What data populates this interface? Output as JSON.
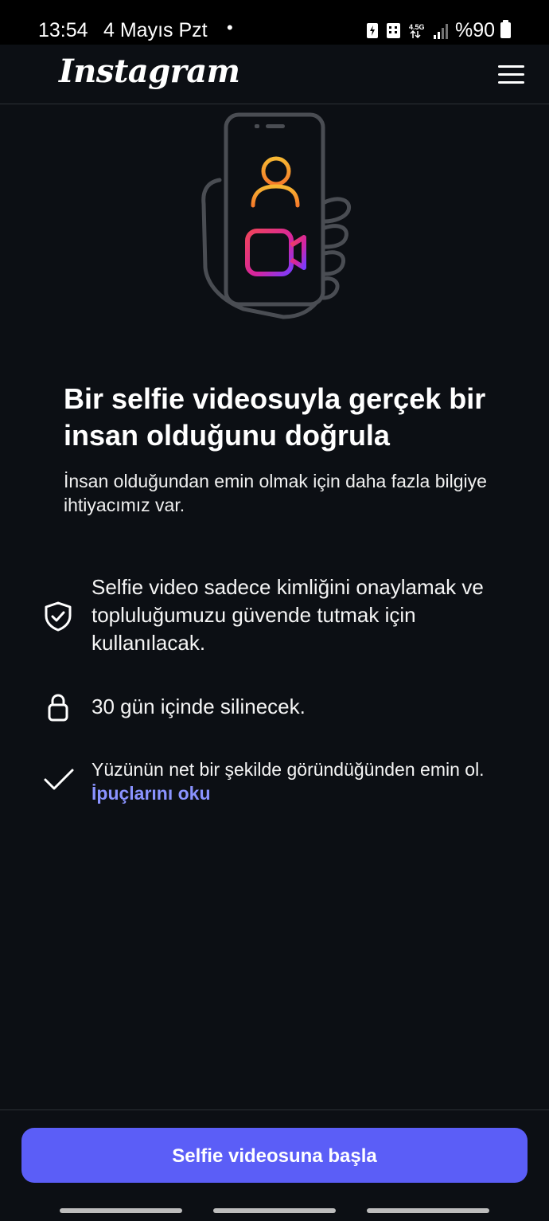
{
  "status_bar": {
    "time": "13:54",
    "date": "4 Mayıs Pzt",
    "dot": "•",
    "battery": "%90",
    "network": "4.5G"
  },
  "header": {
    "logo": "Instagram"
  },
  "content": {
    "title": "Bir selfie videosuyla gerçek bir insan olduğunu doğrula",
    "subtitle": "İnsan olduğundan emin olmak için daha fazla bilgiye ihtiyacımız var.",
    "features": [
      {
        "icon": "shield-check-icon",
        "text": "Selfie video sadece kimliğini onaylamak ve topluluğumuzu güvende tutmak için kullanılacak."
      },
      {
        "icon": "lock-icon",
        "text": "30 gün içinde silinecek."
      },
      {
        "icon": "checkmark-icon",
        "text": "Yüzünün net bir şekilde göründüğünden emin ol.",
        "link": "İpuçlarını oku"
      }
    ]
  },
  "footer": {
    "start_button": "Selfie videosuna başla"
  },
  "colors": {
    "background": "#0c0f14",
    "accent": "#5b5ef7",
    "link": "#8a93ff"
  }
}
